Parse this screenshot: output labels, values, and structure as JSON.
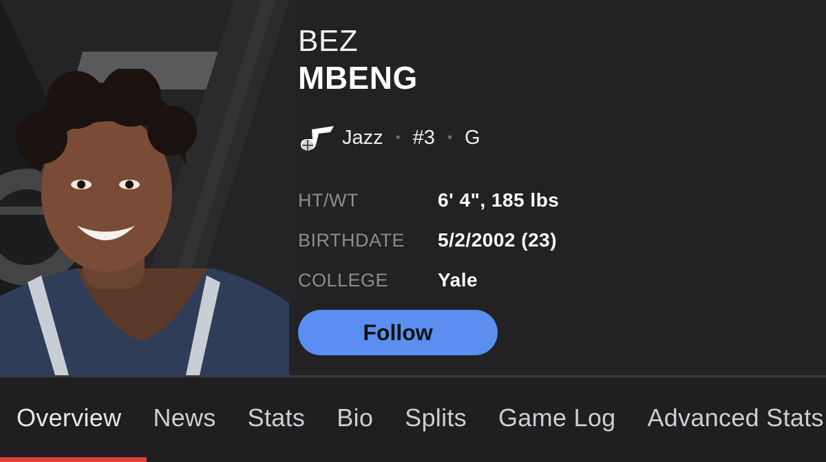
{
  "player": {
    "first_name": "BEZ",
    "last_name": "MBENG",
    "team": "Jazz",
    "team_logo": "jazz-note-logo",
    "number": "#3",
    "position": "G"
  },
  "details": [
    {
      "label": "HT/WT",
      "value": "6' 4\", 185 lbs"
    },
    {
      "label": "BIRTHDATE",
      "value": "5/2/2002 (23)"
    },
    {
      "label": "COLLEGE",
      "value": "Yale"
    }
  ],
  "follow_label": "Follow",
  "tabs": [
    {
      "label": "Overview",
      "active": true
    },
    {
      "label": "News"
    },
    {
      "label": "Stats"
    },
    {
      "label": "Bio"
    },
    {
      "label": "Splits"
    },
    {
      "label": "Game Log"
    },
    {
      "label": "Advanced Stats"
    }
  ],
  "colors": {
    "background": "#1f1f21",
    "follow_button": "#5b8ef0",
    "active_tab_indicator": "#e53d3a",
    "label_gray": "#8d8d91"
  }
}
